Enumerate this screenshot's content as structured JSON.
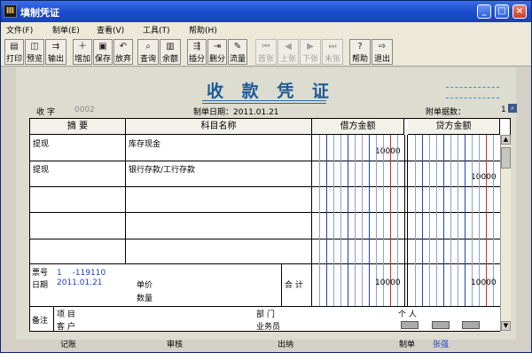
{
  "window": {
    "title": "填制凭证",
    "icon_glyph": "Ⅲ"
  },
  "menu": [
    {
      "label": "文件(F)"
    },
    {
      "label": "制单(E)"
    },
    {
      "label": "查看(V)"
    },
    {
      "label": "工具(T)"
    },
    {
      "label": "帮助(H)"
    }
  ],
  "toolbar": [
    {
      "label": "打印",
      "icon": "printer-icon",
      "glyph": "▤",
      "enabled": true
    },
    {
      "label": "预览",
      "icon": "preview-icon",
      "glyph": "◫",
      "enabled": true
    },
    {
      "label": "输出",
      "icon": "export-icon",
      "glyph": "⇉",
      "enabled": true
    },
    {
      "label": "增加",
      "icon": "add-icon",
      "glyph": "＋",
      "enabled": true
    },
    {
      "label": "保存",
      "icon": "save-icon",
      "glyph": "▣",
      "enabled": true
    },
    {
      "label": "放弃",
      "icon": "undo-icon",
      "glyph": "↶",
      "enabled": true
    },
    {
      "label": "查询",
      "icon": "binoculars-icon",
      "glyph": "⌕",
      "enabled": true
    },
    {
      "label": "余额",
      "icon": "balance-chart-icon",
      "glyph": "▥",
      "enabled": true
    },
    {
      "label": "插分",
      "icon": "insert-row-icon",
      "glyph": "⇶",
      "enabled": true
    },
    {
      "label": "删分",
      "icon": "delete-row-icon",
      "glyph": "⇥",
      "enabled": true
    },
    {
      "label": "流量",
      "icon": "cashflow-icon",
      "glyph": "✎",
      "enabled": true
    },
    {
      "label": "首张",
      "icon": "first-icon",
      "glyph": "⏮",
      "enabled": false
    },
    {
      "label": "上张",
      "icon": "prev-icon",
      "glyph": "◀",
      "enabled": false
    },
    {
      "label": "下张",
      "icon": "next-icon",
      "glyph": "▶",
      "enabled": false
    },
    {
      "label": "末张",
      "icon": "last-icon",
      "glyph": "⏭",
      "enabled": false
    },
    {
      "label": "帮助",
      "icon": "help-icon",
      "glyph": "?",
      "enabled": true
    },
    {
      "label": "退出",
      "icon": "exit-icon",
      "glyph": "⇨",
      "enabled": true
    }
  ],
  "voucher": {
    "title": "收 款 凭 证",
    "word_label": "收 字",
    "word_number": "0002",
    "date_label": "制单日期：2011.01.21",
    "attach_label": "附单据数：",
    "attach_value": "1"
  },
  "grid": {
    "headers": {
      "summary": "摘 要",
      "account": "科目名称",
      "debit": "借方金额",
      "credit": "贷方金额"
    },
    "rows": [
      {
        "summary": "提现",
        "account": "库存现金",
        "debit": "10000",
        "credit": ""
      },
      {
        "summary": "提现",
        "account": "银行存款/工行存款",
        "debit": "",
        "credit": "10000"
      },
      {
        "summary": "",
        "account": "",
        "debit": "",
        "credit": ""
      },
      {
        "summary": "",
        "account": "",
        "debit": "",
        "credit": ""
      }
    ],
    "ticket_label": "票号",
    "ticket_value": "1 　-119110",
    "date_label": "日期",
    "date_value": "2011.01.21",
    "price_label": "单价",
    "qty_label": "数量",
    "total_label": "合 计",
    "total_debit": "10000",
    "total_credit": "10000",
    "remark_label": "备注",
    "project_label": "项 目",
    "customer_label": "客 户",
    "dept_label": "部 门",
    "individual_label": "个 人",
    "salesman_label": "业务员"
  },
  "signoff": {
    "bookkeeping": "记账",
    "review": "审核",
    "cashier": "出纳",
    "maker_label": "制单",
    "maker_name": "张强"
  }
}
